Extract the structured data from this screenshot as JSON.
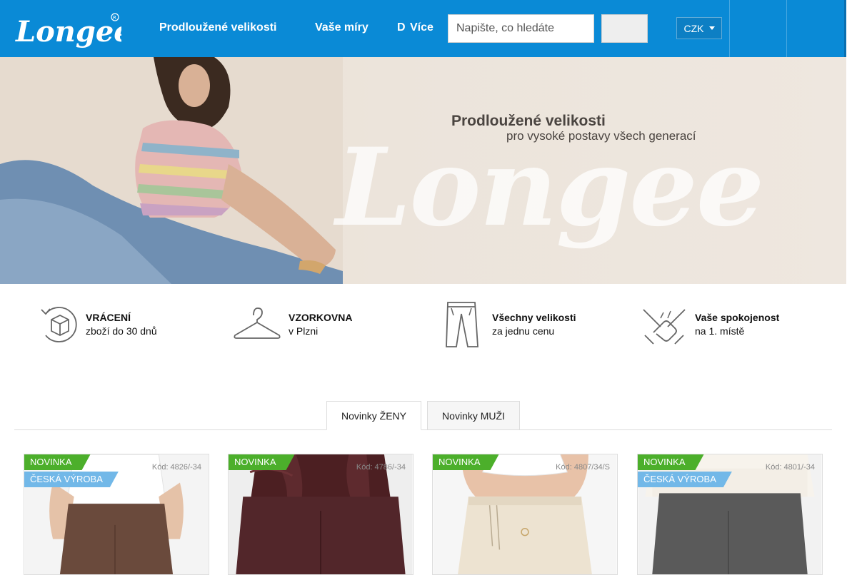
{
  "header": {
    "logo_text": "Longee",
    "nav": [
      {
        "label": "Prodloužené velikosti",
        "chevron": ""
      },
      {
        "label": "Vaše míry"
      },
      {
        "label": "D"
      },
      {
        "label": "Více",
        "chevron": ""
      }
    ],
    "search": {
      "placeholder": "Napište, co hledáte",
      "button_glyph": ""
    },
    "currency": "CZK",
    "user_glyph": "",
    "cart_glyph": ""
  },
  "hero": {
    "title": "Prodloužené velikosti",
    "subtitle": "pro vysoké postavy všech generací",
    "watermark": "Longee"
  },
  "benefits": [
    {
      "title": "VRÁCENÍ",
      "subtitle": "zboží do 30 dnů",
      "icon": "return-box-icon"
    },
    {
      "title": "VZORKOVNA",
      "subtitle": "v Plzni",
      "icon": "hanger-icon"
    },
    {
      "title": "Všechny velikosti",
      "subtitle": "za jednu cenu",
      "icon": "trousers-icon"
    },
    {
      "title": "Vaše spokojenost",
      "subtitle": "na 1. místě",
      "icon": "handshake-icon"
    }
  ],
  "tabs": [
    {
      "label": "Novinky ŽENY",
      "active": true
    },
    {
      "label": "Novinky MUŽI",
      "active": false
    }
  ],
  "products": [
    {
      "badge_new": "NOVINKA",
      "badge_cz": "ČESKÁ VÝROBA",
      "code": "Kód: 4826/-34"
    },
    {
      "badge_new": "NOVINKA",
      "badge_cz": "",
      "code": "Kód: 4786/-34"
    },
    {
      "badge_new": "NOVINKA",
      "badge_cz": "",
      "code": "Kód: 4807/34/S"
    },
    {
      "badge_new": "NOVINKA",
      "badge_cz": "ČESKÁ VÝROBA",
      "code": "Kód: 4801/-34"
    }
  ],
  "colors": {
    "header": "#0a8ad6",
    "badge_new": "#4caf2b",
    "badge_cz": "#72b8e8"
  }
}
